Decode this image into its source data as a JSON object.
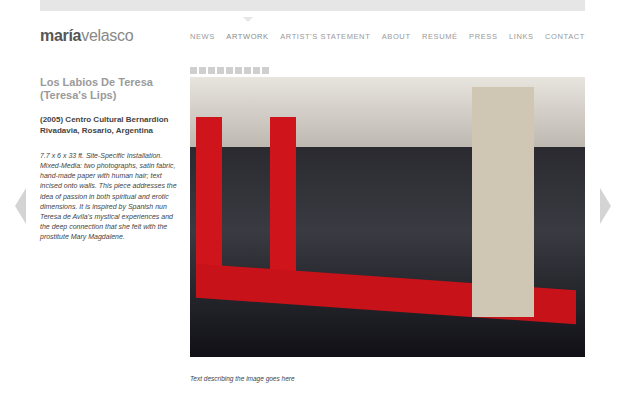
{
  "logo": {
    "bold": "maría",
    "light": "velasco"
  },
  "nav": [
    {
      "label": "NEWS",
      "selected": false
    },
    {
      "label": "ARTWORK",
      "selected": true
    },
    {
      "label": "ARTIST'S STATEMENT",
      "selected": false
    },
    {
      "label": "ABOUT",
      "selected": false
    },
    {
      "label": "RESUMÉ",
      "selected": false
    },
    {
      "label": "PRESS",
      "selected": false
    },
    {
      "label": "LINKS",
      "selected": false
    },
    {
      "label": "CONTACT",
      "selected": false
    }
  ],
  "artwork": {
    "title": "Los Labios De Teresa (Teresa's Lips)",
    "venue": "(2005) Centro Cultural Bernardion Rivadavia, Rosario, Argentina",
    "description": "7.7 x 6 x 33 ft. Site-Specific Installation. Mixed-Media: two photographs, satin fabric, hand-made paper with human hair; text incised onto walls. This piece addresses the idea of passion in both spiritual and erotic dimensions. It is inspired by Spanish nun Teresa de Avila's mystical experiences and the deep connection that she felt with the prostitute Mary Magdalene.",
    "caption": "Text describing the image goes here"
  },
  "thumbnails": [
    {
      "selected": false
    },
    {
      "selected": false
    },
    {
      "selected": false
    },
    {
      "selected": false
    },
    {
      "selected": false
    },
    {
      "selected": false
    },
    {
      "selected": false
    },
    {
      "selected": false
    },
    {
      "selected": false
    }
  ]
}
